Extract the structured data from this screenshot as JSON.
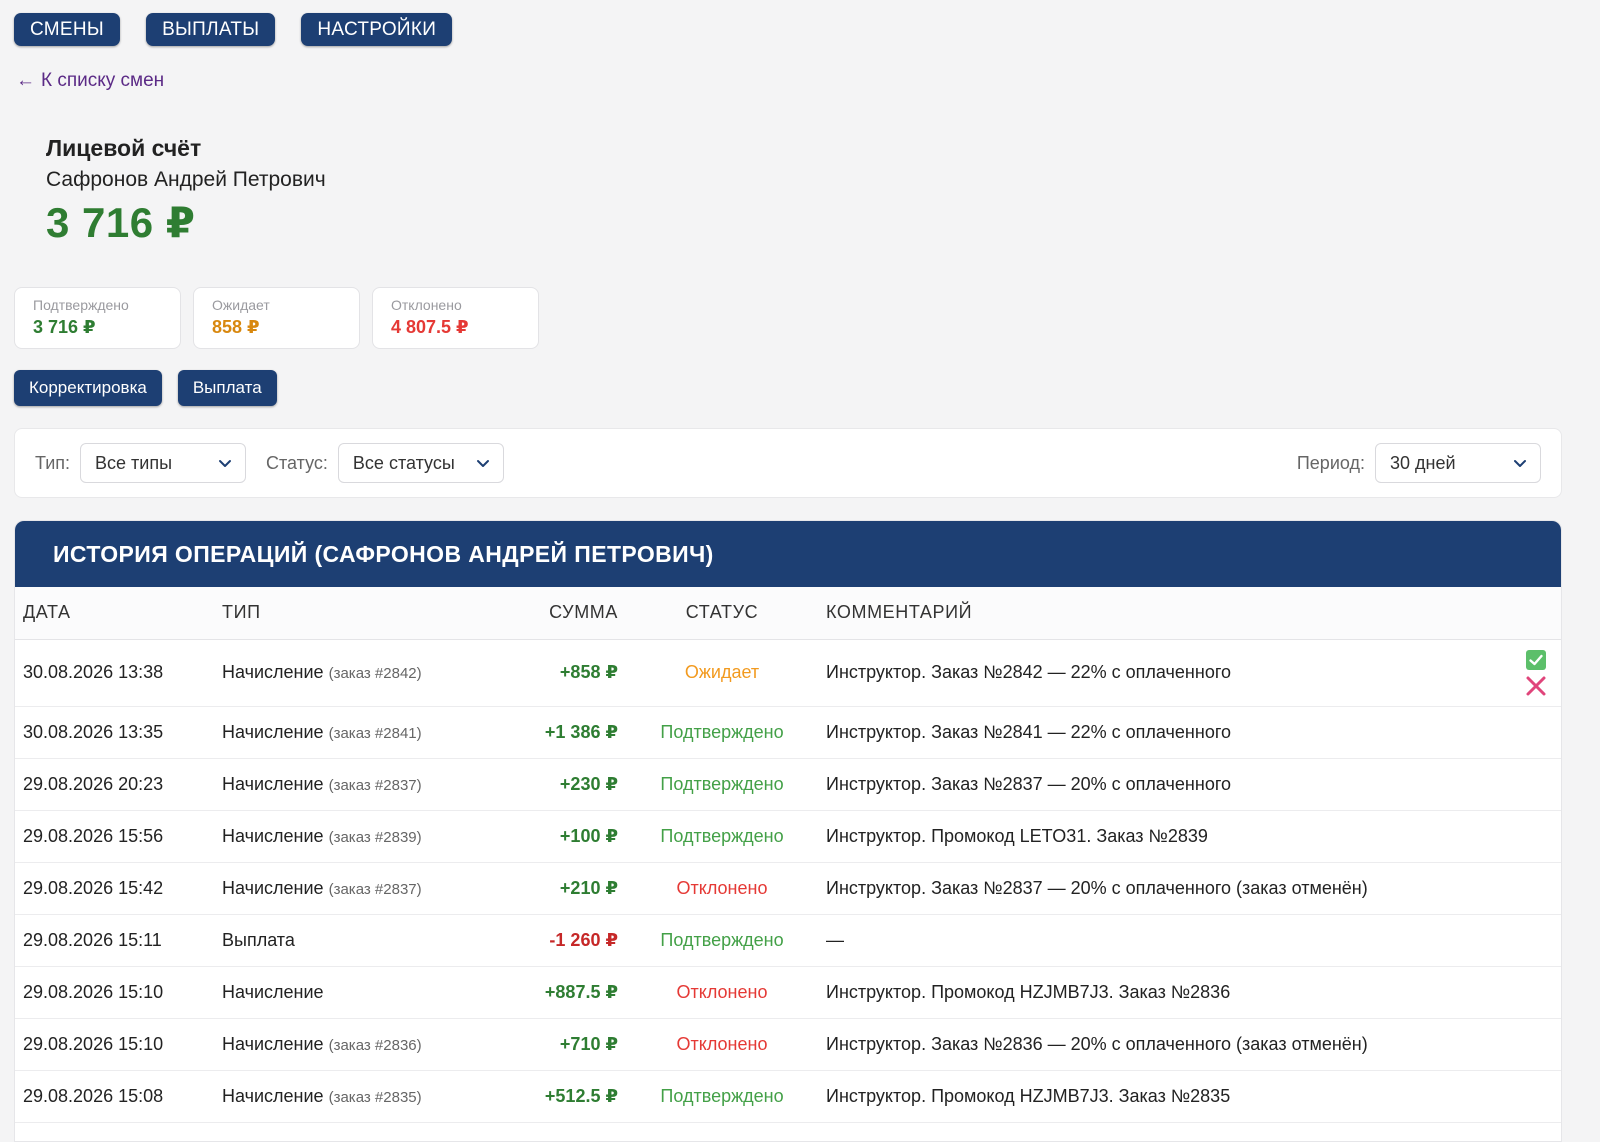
{
  "nav": {
    "items": [
      "СМЕНЫ",
      "ВЫПЛАТЫ",
      "НАСТРОЙКИ"
    ]
  },
  "back_link": "К списку смен",
  "back_arrow": "←",
  "account": {
    "title": "Лицевой счёт",
    "name": "Сафронов Андрей Петрович",
    "balance": "3 716 ₽"
  },
  "summary": [
    {
      "label": "Подтверждено",
      "value": "3 716 ₽",
      "color": "#2e7d32"
    },
    {
      "label": "Ожидает",
      "value": "858 ₽",
      "color": "#d8880f"
    },
    {
      "label": "Отклонено",
      "value": "4 807.5 ₽",
      "color": "#e53935"
    }
  ],
  "actions": {
    "adjust": "Корректировка",
    "payout": "Выплата"
  },
  "filters": {
    "type_label": "Тип:",
    "type_value": "Все типы",
    "status_label": "Статус:",
    "status_value": "Все статусы",
    "period_label": "Период:",
    "period_value": "30 дней"
  },
  "history": {
    "title": "ИСТОРИЯ ОПЕРАЦИЙ (САФРОНОВ АНДРЕЙ ПЕТРОВИЧ)",
    "columns": {
      "date": "ДАТА",
      "type": "ТИП",
      "sum": "СУММА",
      "status": "СТАТУС",
      "comment": "КОММЕНТАРИЙ"
    },
    "rows": [
      {
        "date": "30.08.2026 13:38",
        "type": "Начисление",
        "order": "(заказ #2842)",
        "sum": "+858 ₽",
        "sign": "pos",
        "status": "Ожидает",
        "status_kind": "pending",
        "comment": "Инструктор. Заказ №2842 — 22% с оплаченного",
        "has_actions": true
      },
      {
        "date": "30.08.2026 13:35",
        "type": "Начисление",
        "order": "(заказ #2841)",
        "sum": "+1 386 ₽",
        "sign": "pos",
        "status": "Подтверждено",
        "status_kind": "ok",
        "comment": "Инструктор. Заказ №2841 — 22% с оплаченного",
        "has_actions": false
      },
      {
        "date": "29.08.2026 20:23",
        "type": "Начисление",
        "order": "(заказ #2837)",
        "sum": "+230 ₽",
        "sign": "pos",
        "status": "Подтверждено",
        "status_kind": "ok",
        "comment": "Инструктор. Заказ №2837 — 20% с оплаченного",
        "has_actions": false
      },
      {
        "date": "29.08.2026 15:56",
        "type": "Начисление",
        "order": "(заказ #2839)",
        "sum": "+100 ₽",
        "sign": "pos",
        "status": "Подтверждено",
        "status_kind": "ok",
        "comment": "Инструктор. Промокод LETO31. Заказ №2839",
        "has_actions": false
      },
      {
        "date": "29.08.2026 15:42",
        "type": "Начисление",
        "order": "(заказ #2837)",
        "sum": "+210 ₽",
        "sign": "pos",
        "status": "Отклонено",
        "status_kind": "rej",
        "comment": "Инструктор. Заказ №2837 — 20% с оплаченного (заказ отменён)",
        "has_actions": false
      },
      {
        "date": "29.08.2026 15:11",
        "type": "Выплата",
        "order": "",
        "sum": "-1 260 ₽",
        "sign": "neg",
        "status": "Подтверждено",
        "status_kind": "ok",
        "comment": "—",
        "has_actions": false
      },
      {
        "date": "29.08.2026 15:10",
        "type": "Начисление",
        "order": "",
        "sum": "+887.5 ₽",
        "sign": "pos",
        "status": "Отклонено",
        "status_kind": "rej",
        "comment": "Инструктор. Промокод HZJMB7J3. Заказ №2836",
        "has_actions": false
      },
      {
        "date": "29.08.2026 15:10",
        "type": "Начисление",
        "order": "(заказ #2836)",
        "sum": "+710 ₽",
        "sign": "pos",
        "status": "Отклонено",
        "status_kind": "rej",
        "comment": "Инструктор. Заказ №2836 — 20% с оплаченного (заказ отменён)",
        "has_actions": false
      },
      {
        "date": "29.08.2026 15:08",
        "type": "Начисление",
        "order": "(заказ #2835)",
        "sum": "+512.5 ₽",
        "sign": "pos",
        "status": "Подтверждено",
        "status_kind": "ok",
        "comment": "Инструктор. Промокод HZJMB7J3. Заказ №2835",
        "has_actions": false
      }
    ]
  },
  "icons": {
    "approve": "check-square-icon",
    "reject": "close-icon",
    "dropdown": "chevron-down-icon",
    "back": "arrow-left-icon"
  }
}
